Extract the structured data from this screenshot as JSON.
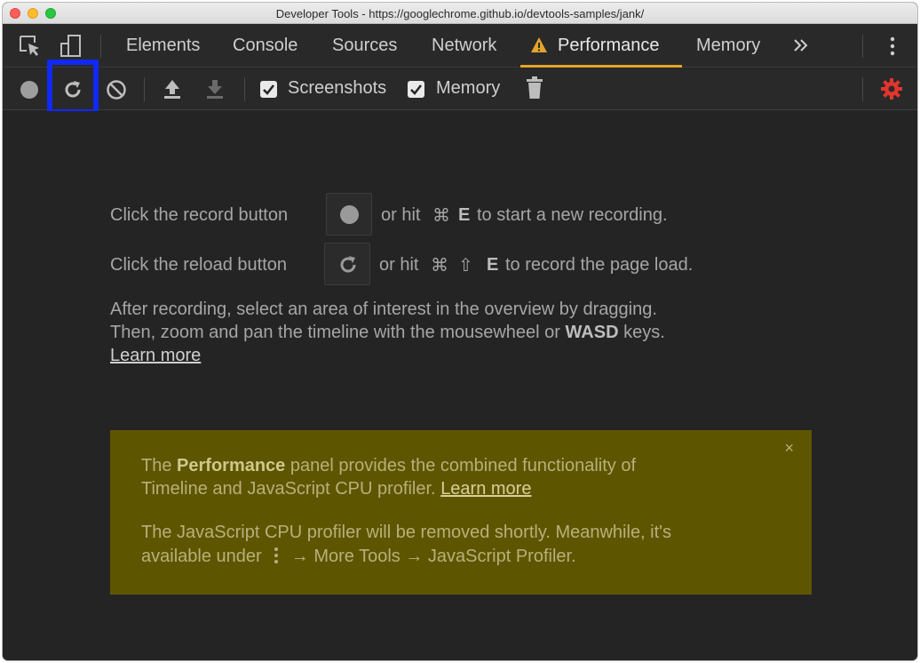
{
  "window": {
    "title": "Developer Tools - https://googlechrome.github.io/devtools-samples/jank/"
  },
  "tabs": [
    "Elements",
    "Console",
    "Sources",
    "Network",
    "Performance",
    "Memory"
  ],
  "active_tab": "Performance",
  "toolbar": {
    "screenshots_label": "Screenshots",
    "memory_label": "Memory",
    "screenshots_checked": true,
    "memory_checked": true,
    "accent_settings_color": "#e3352d",
    "highlight_color": "#1029f5"
  },
  "main": {
    "record_prefix": "Click the record button",
    "record_mid": "or hit",
    "record_cmd": "⌘",
    "record_key": "E",
    "record_suffix": "to start a new recording.",
    "reload_prefix": "Click the reload button",
    "reload_mid": "or hit",
    "reload_cmd": "⌘",
    "reload_shift": "⇧",
    "reload_key": "E",
    "reload_suffix": "to record the page load.",
    "info_line1": "After recording, select an area of interest in the overview by dragging.",
    "info_line2_prefix": "Then, zoom and pan the timeline with the mousewheel or",
    "info_line2_bold": "WASD",
    "info_line2_suffix": "keys.",
    "learn_more": "Learn more"
  },
  "banner": {
    "line1_prefix": "The",
    "line1_bold": "Performance",
    "line1_suffix": "panel provides the combined functionality of",
    "line2_prefix": "Timeline and JavaScript CPU profiler.",
    "line2_link": "Learn more",
    "line3": "The JavaScript CPU profiler will be removed shortly. Meanwhile, it's",
    "line4_prefix": "available under",
    "line4_suffix": "→ More Tools → JavaScript Profiler.",
    "close": "×",
    "color": "#5e5500"
  }
}
